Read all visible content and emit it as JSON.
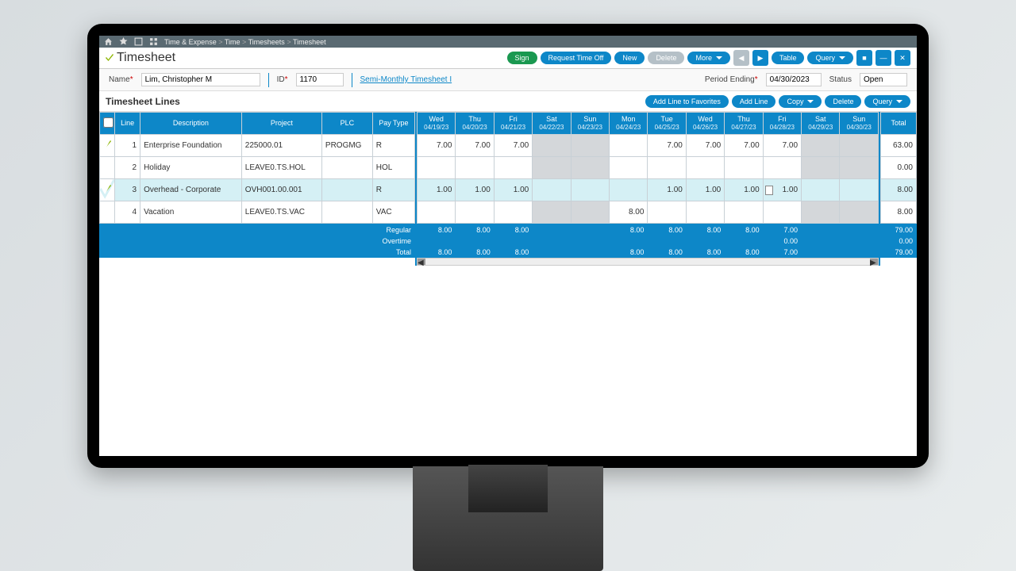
{
  "breadcrumb": [
    "Time & Expense",
    "Time",
    "Timesheets",
    "Timesheet"
  ],
  "page_title": "Timesheet",
  "header_buttons": {
    "sign": "Sign",
    "request_time_off": "Request Time Off",
    "new": "New",
    "delete": "Delete",
    "more": "More",
    "table": "Table",
    "query": "Query"
  },
  "info": {
    "name_label": "Name",
    "name_value": "Lim, Christopher M",
    "id_label": "ID",
    "id_value": "1170",
    "schedule_link": "Semi-Monthly Timesheet I",
    "period_label": "Period Ending",
    "period_value": "04/30/2023",
    "status_label": "Status",
    "status_value": "Open"
  },
  "lines_title": "Timesheet Lines",
  "lines_buttons": {
    "add_fav": "Add Line to Favorites",
    "add_line": "Add Line",
    "copy": "Copy",
    "delete": "Delete",
    "query": "Query"
  },
  "cols_left": [
    "Line",
    "Description",
    "Project",
    "PLC",
    "Pay Type"
  ],
  "days": [
    {
      "dow": "Wed",
      "date": "04/19/23"
    },
    {
      "dow": "Thu",
      "date": "04/20/23"
    },
    {
      "dow": "Fri",
      "date": "04/21/23"
    },
    {
      "dow": "Sat",
      "date": "04/22/23"
    },
    {
      "dow": "Sun",
      "date": "04/23/23"
    },
    {
      "dow": "Mon",
      "date": "04/24/23"
    },
    {
      "dow": "Tue",
      "date": "04/25/23"
    },
    {
      "dow": "Wed",
      "date": "04/26/23"
    },
    {
      "dow": "Thu",
      "date": "04/27/23"
    },
    {
      "dow": "Fri",
      "date": "04/28/23"
    },
    {
      "dow": "Sat",
      "date": "04/29/23"
    },
    {
      "dow": "Sun",
      "date": "04/30/23"
    }
  ],
  "total_label": "Total",
  "rows": [
    {
      "checked": true,
      "line": "1",
      "desc": "Enterprise Foundation",
      "project": "225000.01",
      "plc": "PROGMG",
      "pay": "R",
      "cells": [
        "7.00",
        "7.00",
        "7.00",
        "",
        "",
        "",
        "7.00",
        "7.00",
        "7.00",
        "7.00",
        "",
        ""
      ],
      "total": "63.00"
    },
    {
      "checked": false,
      "line": "2",
      "desc": "Holiday",
      "project": "LEAVE0.TS.HOL",
      "plc": "",
      "pay": "HOL",
      "cells": [
        "",
        "",
        "",
        "",
        "",
        "",
        "",
        "",
        "",
        "",
        "",
        ""
      ],
      "total": "0.00"
    },
    {
      "checked": true,
      "line": "3",
      "desc": "Overhead - Corporate",
      "project": "OVH001.00.001",
      "plc": "",
      "pay": "R",
      "cells": [
        "1.00",
        "1.00",
        "1.00",
        "",
        "",
        "",
        "1.00",
        "1.00",
        "1.00",
        "1.00",
        "",
        ""
      ],
      "total": "8.00",
      "selected": true,
      "edit_col": 9,
      "edit_val": "1.00"
    },
    {
      "checked": false,
      "line": "4",
      "desc": "Vacation",
      "project": "LEAVE0.TS.VAC",
      "plc": "",
      "pay": "VAC",
      "cells": [
        "",
        "",
        "",
        "",
        "",
        "8.00",
        "",
        "",
        "",
        "",
        "",
        ""
      ],
      "total": "8.00"
    }
  ],
  "summary": {
    "labels": [
      "Regular",
      "Overtime",
      "Total"
    ],
    "regular": [
      "8.00",
      "8.00",
      "8.00",
      "",
      "",
      "8.00",
      "8.00",
      "8.00",
      "8.00",
      "7.00",
      "",
      ""
    ],
    "overtime": [
      "",
      "",
      "",
      "",
      "",
      "",
      "",
      "",
      "",
      "0.00",
      "",
      ""
    ],
    "total": [
      "8.00",
      "8.00",
      "8.00",
      "",
      "",
      "8.00",
      "8.00",
      "8.00",
      "8.00",
      "7.00",
      "",
      ""
    ],
    "grand": [
      "79.00",
      "0.00",
      "79.00"
    ]
  },
  "weekend_cols": [
    3,
    4,
    10,
    11
  ],
  "hdr_checkbox_state": false
}
